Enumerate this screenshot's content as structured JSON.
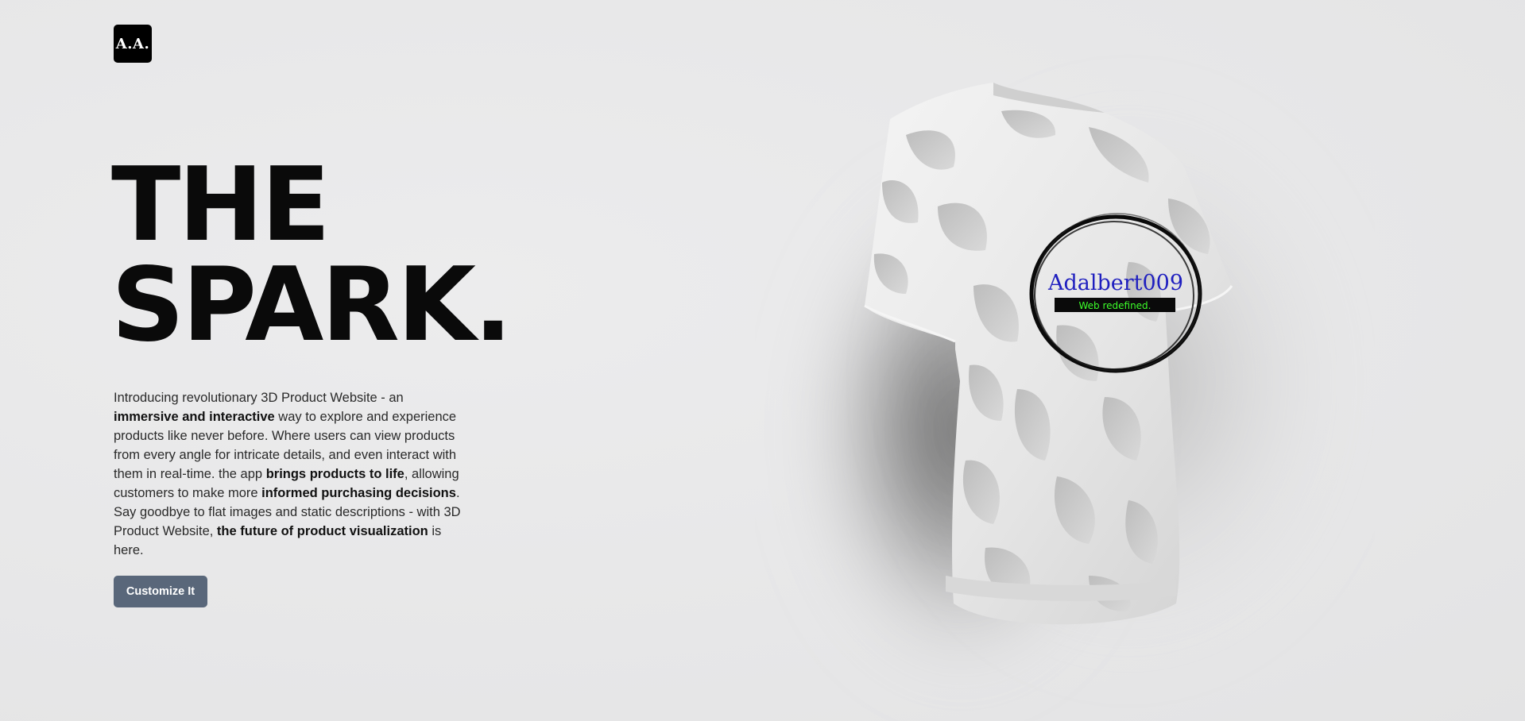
{
  "logo": {
    "text": "A.A."
  },
  "hero": {
    "title_line1": "THE",
    "title_line2": "SPARK."
  },
  "description": {
    "p1": "Introducing revolutionary 3D Product Website - an ",
    "b1": "immersive and interactive",
    "p2": " way to explore and experience products like never before. Where users can view products from every angle for intricate details, and even interact with them in real-time. the app ",
    "b2": "brings products to life",
    "p3": ", allowing customers to make more ",
    "b3": "informed purchasing decisions",
    "p4": ". Say goodbye to flat images and static descriptions - with 3D Product Website, ",
    "b4": "the future of product visualization",
    "p5": " is here."
  },
  "cta": {
    "label": "Customize It"
  },
  "shirt": {
    "logo_title": "Adalbert009",
    "logo_tagline": "Web redefined.",
    "logo_title_color": "#1f1fbf",
    "logo_tagline_color": "#3cff2a"
  }
}
